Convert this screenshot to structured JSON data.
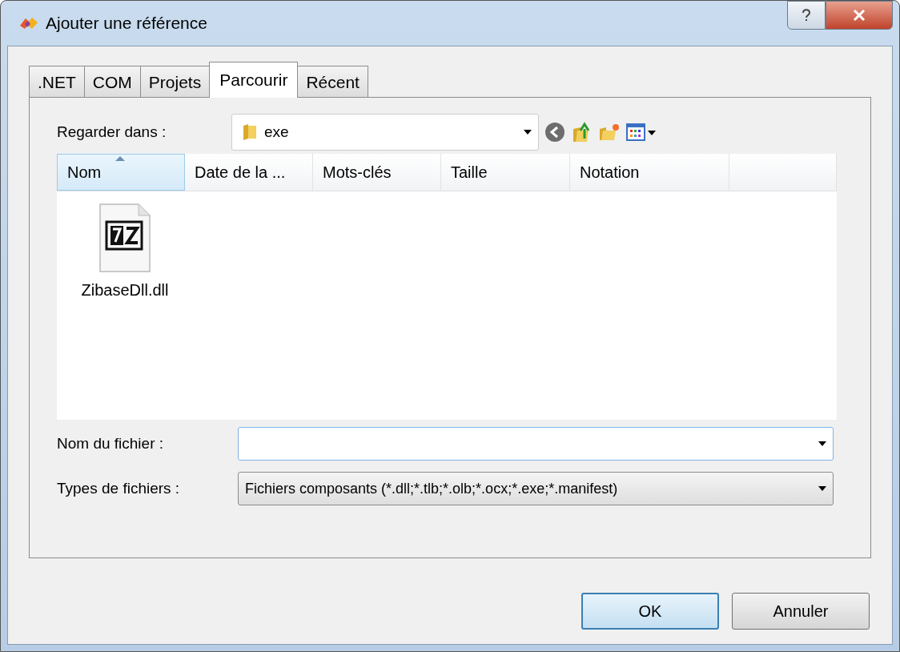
{
  "window": {
    "title": "Ajouter une référence"
  },
  "tabs": [
    {
      "label": ".NET",
      "selected": false
    },
    {
      "label": "COM",
      "selected": false
    },
    {
      "label": "Projets",
      "selected": false
    },
    {
      "label": "Parcourir",
      "selected": true
    },
    {
      "label": "Récent",
      "selected": false
    }
  ],
  "look_in": {
    "label": "Regarder dans :",
    "value": "exe"
  },
  "file_list": {
    "columns": [
      {
        "label": "Nom",
        "sorted": true
      },
      {
        "label": "Date de la ...",
        "sorted": false
      },
      {
        "label": "Mots-clés",
        "sorted": false
      },
      {
        "label": "Taille",
        "sorted": false
      },
      {
        "label": "Notation",
        "sorted": false
      }
    ],
    "items": [
      {
        "name": "ZibaseDll.dll"
      }
    ]
  },
  "file_name": {
    "label": "Nom du fichier :"
  },
  "file_types": {
    "label": "Types de fichiers :",
    "value": "Fichiers composants (*.dll;*.tlb;*.olb;*.ocx;*.exe;*.manifest)"
  },
  "buttons": [
    {
      "label": "OK",
      "default": true
    },
    {
      "label": "Annuler",
      "default": false
    }
  ]
}
